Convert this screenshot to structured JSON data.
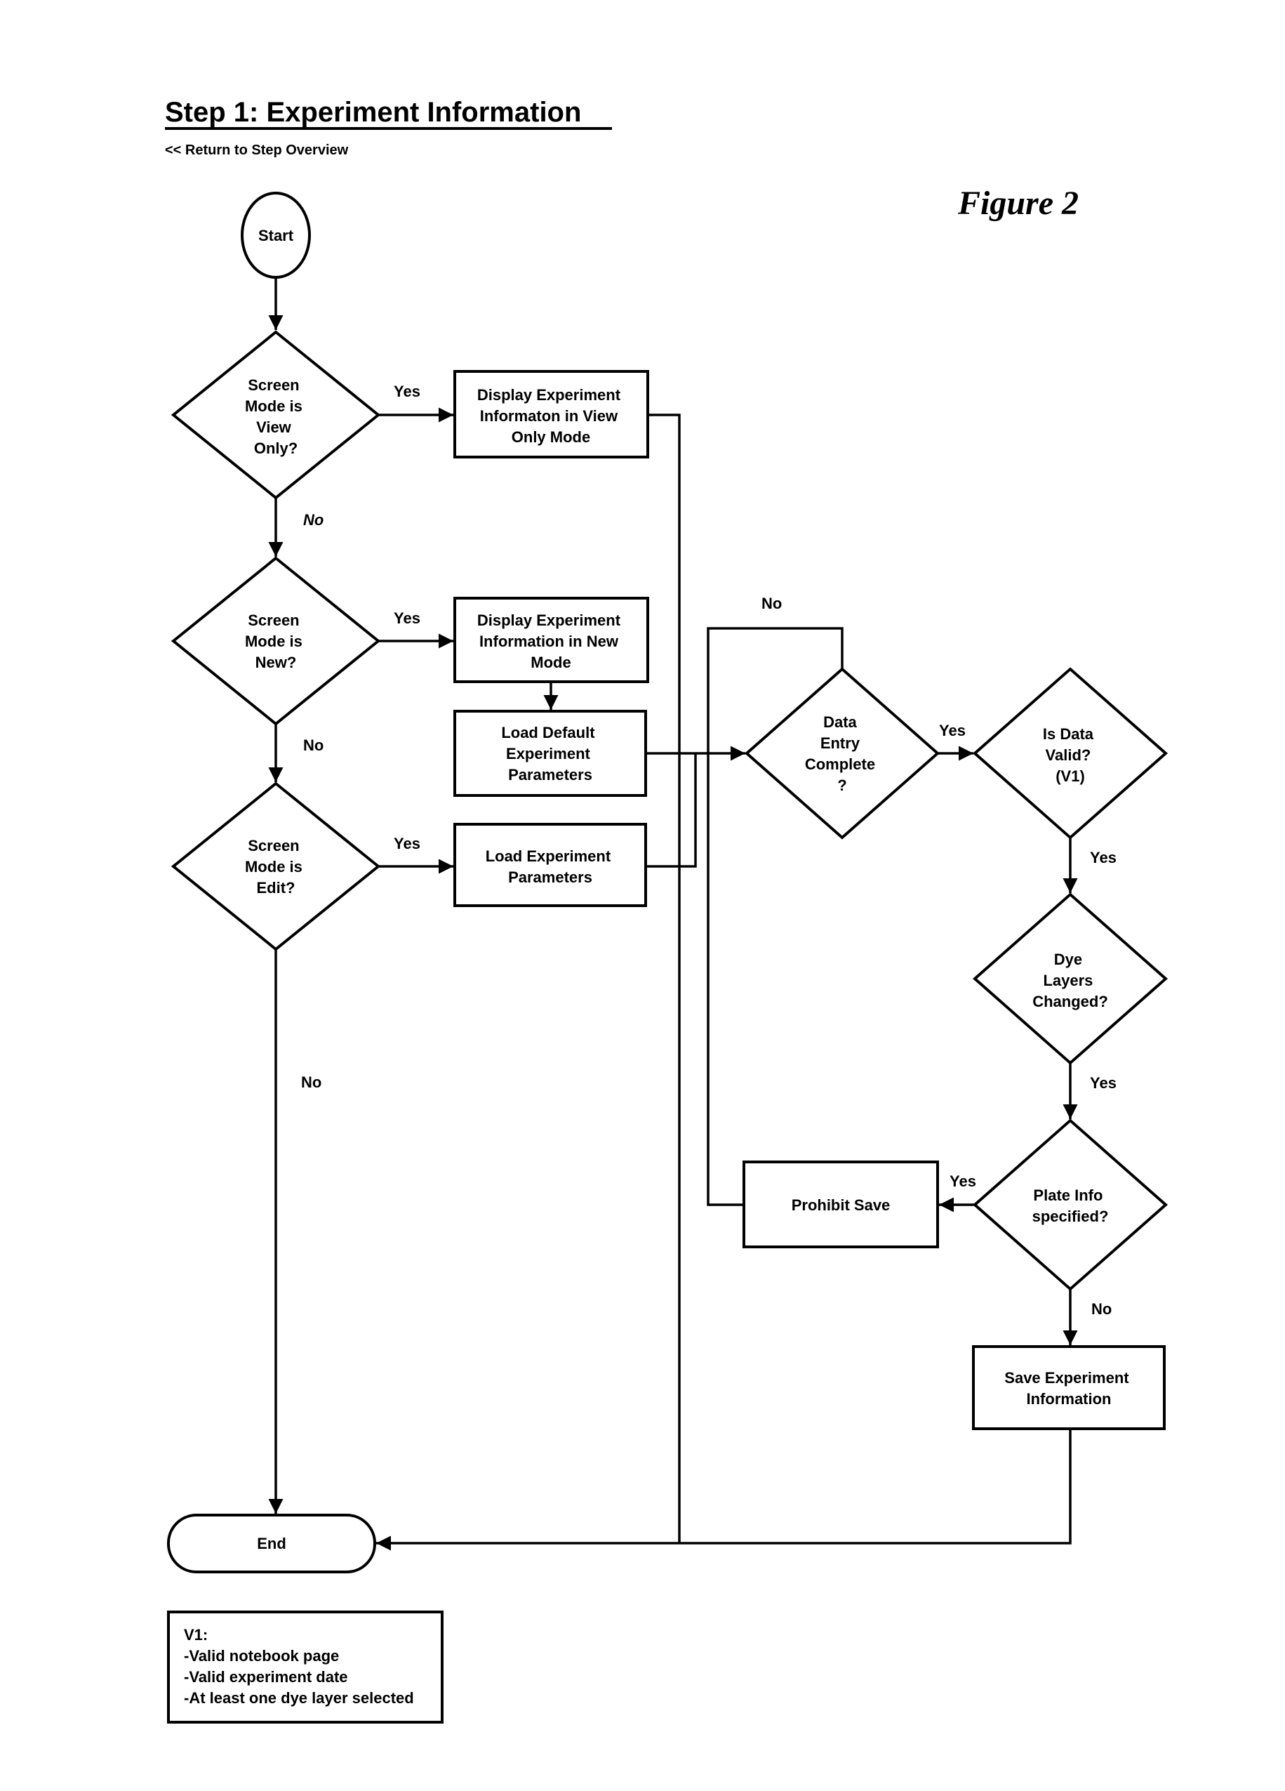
{
  "header": {
    "title": "Step 1:  Experiment Information",
    "back_link": "<< Return to Step Overview",
    "figure_label": "Figure 2"
  },
  "nodes": {
    "start": "Start",
    "end": "End",
    "d_view_only": [
      "Screen",
      "Mode is",
      "View",
      "Only?"
    ],
    "d_new": [
      "Screen",
      "Mode is",
      "New?"
    ],
    "d_edit": [
      "Screen",
      "Mode is",
      "Edit?"
    ],
    "p_display_view": [
      "Display Experiment",
      "Informaton in View",
      "Only Mode"
    ],
    "p_display_new": [
      "Display Experiment",
      "Information in New",
      "Mode"
    ],
    "p_load_default": [
      "Load Default",
      "Experiment",
      "Parameters"
    ],
    "p_load_params": [
      "Load Experiment",
      "Parameters"
    ],
    "d_data_entry": [
      "Data",
      "Entry",
      "Complete",
      "?"
    ],
    "d_data_valid": [
      "Is Data",
      "Valid?",
      "(V1)"
    ],
    "d_dye_layers": [
      "Dye",
      "Layers",
      "Changed?"
    ],
    "d_plate_info": [
      "Plate Info",
      "specified?"
    ],
    "p_prohibit": [
      "Prohibit Save"
    ],
    "p_save": [
      "Save Experiment",
      "Information"
    ]
  },
  "edge_labels": {
    "view_yes": "Yes",
    "view_no": "No",
    "new_yes": "Yes",
    "new_no": "No",
    "edit_yes": "Yes",
    "edit_no": "No",
    "entry_no": "No",
    "entry_yes": "Yes",
    "valid_yes": "Yes",
    "dye_yes": "Yes",
    "plate_yes": "Yes",
    "plate_no": "No"
  },
  "note": {
    "title": "V1:",
    "items": [
      "-Valid notebook page",
      "-Valid experiment date",
      "-At least one dye layer selected"
    ]
  }
}
